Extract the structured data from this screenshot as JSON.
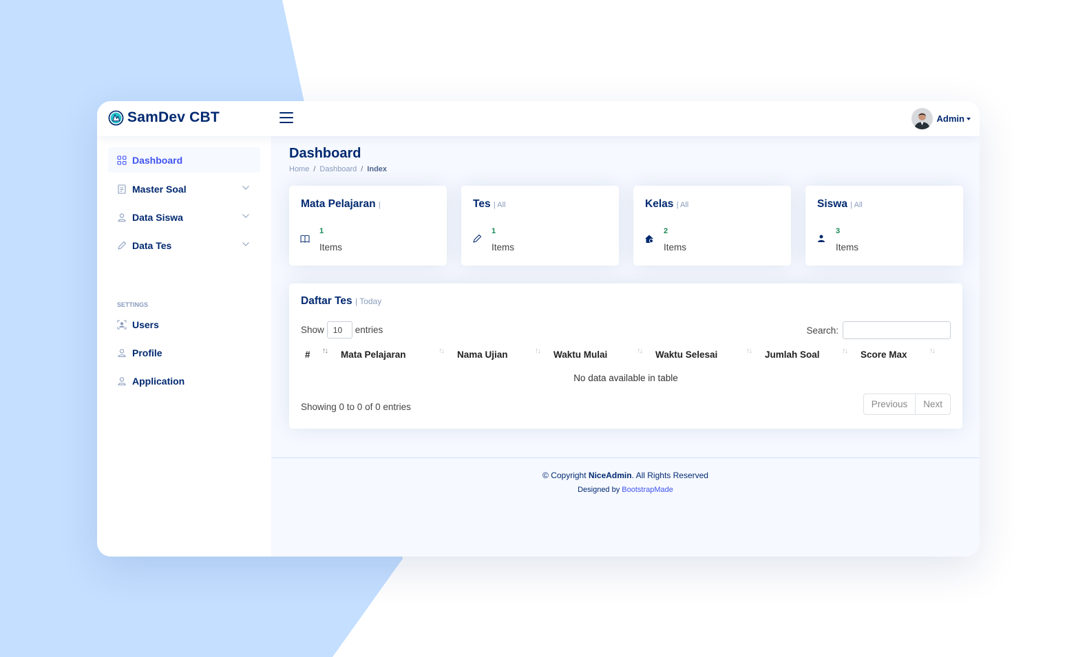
{
  "app": {
    "brand": "SamDev CBT"
  },
  "header": {
    "user_name": "Admin"
  },
  "sidebar": {
    "items": [
      {
        "label": "Dashboard",
        "icon": "grid-icon",
        "active": true
      },
      {
        "label": "Master Soal",
        "icon": "journal-icon"
      },
      {
        "label": "Data Siswa",
        "icon": "person-icon"
      },
      {
        "label": "Data Tes",
        "icon": "pencil-icon"
      }
    ],
    "settings_heading": "SETTINGS",
    "settings_items": [
      {
        "label": "Users",
        "icon": "person-badge-icon"
      },
      {
        "label": "Profile",
        "icon": "person-icon"
      },
      {
        "label": "Application",
        "icon": "person-icon"
      }
    ]
  },
  "page": {
    "title": "Dashboard",
    "breadcrumb": [
      "Home",
      "Dashboard",
      "Index"
    ],
    "breadcrumb_sep": "/"
  },
  "stats": [
    {
      "title": "Mata Pelajaran",
      "sub": "|",
      "count": "1",
      "label": "Items",
      "icon": "book-icon"
    },
    {
      "title": "Tes",
      "sub": "| All",
      "count": "1",
      "label": "Items",
      "icon": "pencil-icon"
    },
    {
      "title": "Kelas",
      "sub": "| All",
      "count": "2",
      "label": "Items",
      "icon": "house-icon"
    },
    {
      "title": "Siswa",
      "sub": "| All",
      "count": "3",
      "label": "Items",
      "icon": "person-icon"
    }
  ],
  "table": {
    "title": "Daftar Tes",
    "sub": "| Today",
    "show_label": "Show",
    "entries_value": "10",
    "entries_label": "entries",
    "search_label": "Search:",
    "search_value": "",
    "columns": [
      "#",
      "Mata Pelajaran",
      "Nama Ujian",
      "Waktu Mulai",
      "Waktu Selesai",
      "Jumlah Soal",
      "Score Max"
    ],
    "empty_text": "No data available in table",
    "info": "Showing 0 to 0 of 0 entries",
    "prev_label": "Previous",
    "next_label": "Next"
  },
  "footer": {
    "copyright_prefix": "© Copyright",
    "brand": "NiceAdmin",
    "copyright_suffix": ". All Rights Reserved",
    "designed_prefix": "Designed by",
    "designer": "BootstrapMade"
  },
  "colors": {
    "primary_dark": "#012970",
    "accent": "#4154f1",
    "success": "#198754",
    "background_shape": "#c4dfff"
  }
}
